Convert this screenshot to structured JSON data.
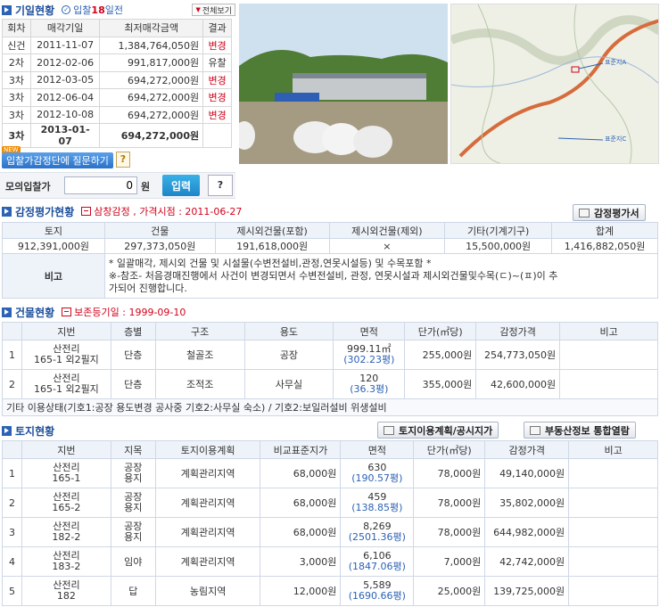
{
  "auction": {
    "title": "기일현황",
    "bid_status": "입찰",
    "bid_days": "18",
    "bid_days_suffix": "일전",
    "view_all_label": "전체보기",
    "columns": [
      "회차",
      "매각기일",
      "최저매각금액",
      "결과"
    ],
    "rows": [
      {
        "round": "신건",
        "date": "2011-11-07",
        "amount": "1,384,764,050원",
        "result": "변경"
      },
      {
        "round": "2차",
        "date": "2012-02-06",
        "amount": "991,817,000원",
        "result": "유찰"
      },
      {
        "round": "3차",
        "date": "2012-03-05",
        "amount": "694,272,000원",
        "result": "변경"
      },
      {
        "round": "3차",
        "date": "2012-06-04",
        "amount": "694,272,000원",
        "result": "변경"
      },
      {
        "round": "3차",
        "date": "2012-10-08",
        "amount": "694,272,000원",
        "result": "변경"
      },
      {
        "round": "3차",
        "date": "2013-01-07",
        "amount": "694,272,000원",
        "result": ""
      }
    ],
    "new_badge": "NEW",
    "ask_label": "입찰가감정단에 질문하기",
    "help_label": "?"
  },
  "mock_bid": {
    "label": "모의입찰가",
    "value": "0",
    "unit": "원",
    "submit_label": "입력",
    "help_label": "?"
  },
  "appraisal": {
    "title": "감정평가현황",
    "sub_note": "삼창감정 , 가격시점 : 2011-06-27",
    "doc_button": "감정평가서",
    "columns": [
      "토지",
      "건물",
      "제시외건물(포함)",
      "제시외건물(제외)",
      "기타(기계기구)",
      "합계"
    ],
    "values": [
      "912,391,000원",
      "297,373,050원",
      "191,618,000원",
      "×",
      "15,500,000원",
      "1,416,882,050원"
    ],
    "note_label": "비고",
    "note_lines": [
      "* 일괄매각, 제시외 건물 및 시설물(수변전설비,관정,연못시설등) 및 수목포함 *",
      "※-참조- 처음경매진행에서 사건이 변경되면서 수변전설비, 관정, 연못시설과 제시외건물및수목(ㄷ)~(ㅍ)이 추",
      "가되어 진행합니다."
    ]
  },
  "building": {
    "title": "건물현황",
    "sub_note": "보존등기일 : 1999-09-10",
    "columns": [
      "지번",
      "층별",
      "구조",
      "용도",
      "면적",
      "단가(㎡당)",
      "감정가격",
      "비고"
    ],
    "rows": [
      {
        "no": "1",
        "lot1": "산전리",
        "lot2": "165-1 외2필지",
        "floor": "단층",
        "structure": "철골조",
        "use": "공장",
        "area": "999.11㎡",
        "area_py": "(302.23평)",
        "unit_price": "255,000원",
        "price": "254,773,050원",
        "note": ""
      },
      {
        "no": "2",
        "lot1": "산전리",
        "lot2": "165-1 외2필지",
        "floor": "단층",
        "structure": "조적조",
        "use": "사무실",
        "area": "120",
        "area_py": "(36.3평)",
        "unit_price": "355,000원",
        "price": "42,600,000원",
        "note": ""
      }
    ],
    "etc_note": "기타 이용상태(기호1:공장 용도변경 공사중 기호2:사무실 숙소) / 기호2:보일러설비 위생설비"
  },
  "land": {
    "title": "토지현황",
    "plan_button": "토지이용계획/공시지가",
    "realty_button": "부동산정보 통합열람",
    "columns": [
      "지번",
      "지목",
      "토지이용계획",
      "비교표준지가",
      "면적",
      "단가(㎡당)",
      "감정가격",
      "비고"
    ],
    "rows": [
      {
        "no": "1",
        "lot1": "산전리",
        "lot2": "165-1",
        "type1": "공장",
        "type2": "용지",
        "plan": "계획관리지역",
        "std_price": "68,000원",
        "area": "630",
        "area_py": "(190.57평)",
        "unit_price": "78,000원",
        "price": "49,140,000원",
        "note": ""
      },
      {
        "no": "2",
        "lot1": "산전리",
        "lot2": "165-2",
        "type1": "공장",
        "type2": "용지",
        "plan": "계획관리지역",
        "std_price": "68,000원",
        "area": "459",
        "area_py": "(138.85평)",
        "unit_price": "78,000원",
        "price": "35,802,000원",
        "note": ""
      },
      {
        "no": "3",
        "lot1": "산전리",
        "lot2": "182-2",
        "type1": "공장",
        "type2": "용지",
        "plan": "계획관리지역",
        "std_price": "68,000원",
        "area": "8,269",
        "area_py": "(2501.36평)",
        "unit_price": "78,000원",
        "price": "644,982,000원",
        "note": ""
      },
      {
        "no": "4",
        "lot1": "산전리",
        "lot2": "183-2",
        "type1": "임야",
        "type2": "",
        "plan": "계획관리지역",
        "std_price": "3,000원",
        "area": "6,106",
        "area_py": "(1847.06평)",
        "unit_price": "7,000원",
        "price": "42,742,000원",
        "note": ""
      },
      {
        "no": "5",
        "lot1": "산전리",
        "lot2": "182",
        "type1": "답",
        "type2": "",
        "plan": "농림지역",
        "std_price": "12,000원",
        "area": "5,589",
        "area_py": "(1690.66평)",
        "unit_price": "25,000원",
        "price": "139,725,000원",
        "note": ""
      }
    ]
  },
  "map": {
    "labels": [
      "표준지A",
      "표준지C"
    ]
  },
  "colors": {
    "accent": "#2b62b5",
    "alert": "#d0021b",
    "header_bg": "#eef3fa"
  }
}
